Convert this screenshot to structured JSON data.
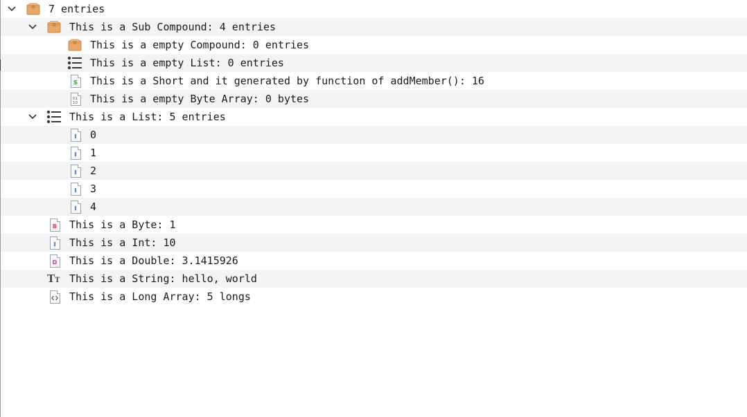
{
  "root": {
    "label": "7 entries",
    "icon": "compound-package-icon",
    "expanded": true
  },
  "sub_compound": {
    "label": "This is a Sub Compound: 4 entries",
    "icon": "compound-package-icon",
    "expanded": true,
    "children": [
      {
        "label": "This is a empty Compound: 0 entries",
        "icon": "compound-package-icon"
      },
      {
        "label": "This is a empty List: 0 entries",
        "icon": "list-icon"
      },
      {
        "label": "This is a Short and it generated by function of addMember(): 16",
        "icon": "short-s-icon"
      },
      {
        "label": "This is a empty Byte Array: 0 bytes",
        "icon": "byte-array-icon"
      }
    ]
  },
  "list": {
    "label": "This is a List: 5 entries",
    "icon": "list-icon",
    "expanded": true,
    "children": [
      {
        "label": "0",
        "icon": "int-i-icon"
      },
      {
        "label": "1",
        "icon": "int-i-icon"
      },
      {
        "label": "2",
        "icon": "int-i-icon"
      },
      {
        "label": "3",
        "icon": "int-i-icon"
      },
      {
        "label": "4",
        "icon": "int-i-icon"
      }
    ]
  },
  "leaves": [
    {
      "label": "This is a Byte: 1",
      "icon": "byte-b-icon"
    },
    {
      "label": "This is a Int: 10",
      "icon": "int-i-icon"
    },
    {
      "label": "This is a Double: 3.1415926",
      "icon": "double-d-icon"
    },
    {
      "label": "This is a String: hello, world",
      "icon": "string-tt-icon"
    },
    {
      "label": "This is a Long Array: 5 longs",
      "icon": "long-array-icon"
    }
  ],
  "colors": {
    "package": "#e8a868",
    "package_dark": "#c98a4e",
    "byte_letter": "#d04a6a",
    "short_letter": "#3f9a4a",
    "int_letter": "#3d6fb8",
    "double_letter": "#b44ab4",
    "alt_row": "#f3f3f3"
  }
}
